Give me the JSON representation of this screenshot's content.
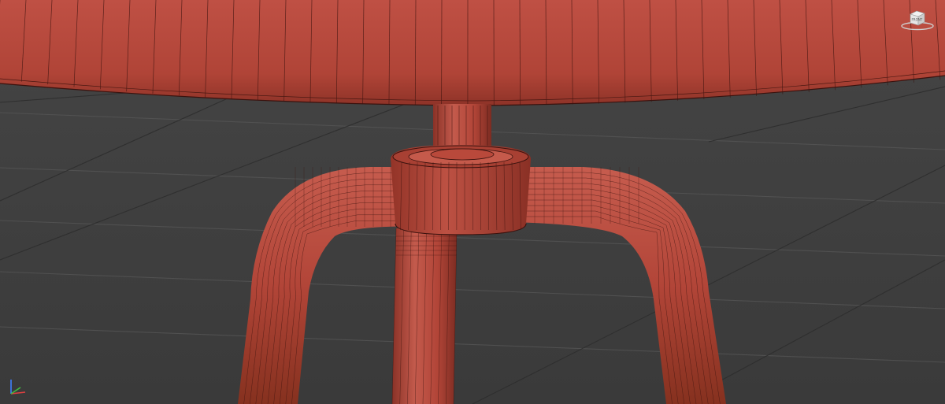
{
  "app": {
    "type": "3d-modeling-viewport",
    "shading_mode": "wireframe-over-shaded"
  },
  "viewport": {
    "background_color": "#3d3d3d",
    "grid_color": "#2a2a2a",
    "model_color": "#b34a3c",
    "wire_color": "#3a120e"
  },
  "viewcube": {
    "label": "FRONT",
    "icon": "viewcube-icon"
  },
  "axis_tripod": {
    "icon": "axis-tripod-icon",
    "x_color": "#e04040",
    "y_color": "#40c040",
    "z_color": "#4080ff"
  },
  "model": {
    "name": "stool",
    "parts": [
      "seat",
      "center-post",
      "hub-collar",
      "leg-left",
      "leg-center",
      "leg-right"
    ]
  }
}
